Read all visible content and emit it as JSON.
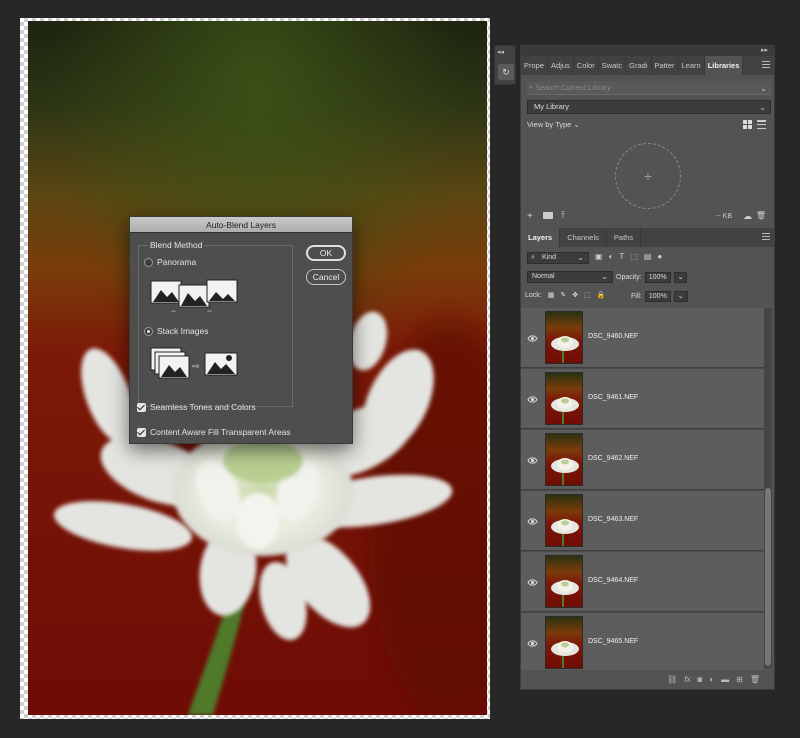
{
  "dialog": {
    "title": "Auto-Blend Layers",
    "blend_method_label": "Blend Method",
    "options": [
      {
        "label": "Panorama",
        "selected": false
      },
      {
        "label": "Stack Images",
        "selected": true
      }
    ],
    "checkboxes": [
      {
        "label": "Seamless Tones and Colors",
        "checked": true
      },
      {
        "label": "Content Aware Fill Transparent Areas",
        "checked": true
      }
    ],
    "ok_label": "OK",
    "cancel_label": "Cancel"
  },
  "panel_tabs": [
    "Prope",
    "Adjus",
    "Color",
    "Swatc",
    "Gradi",
    "Patter",
    "Learn",
    "Libraries"
  ],
  "libraries": {
    "search_placeholder": "Search Current Library",
    "selected_library": "My Library",
    "view_by": "View by Type",
    "storage": "-- KB"
  },
  "layers_panel": {
    "tabs": [
      "Layers",
      "Channels",
      "Paths"
    ],
    "filter_kind": "Kind",
    "blend_mode": "Normal",
    "opacity_label": "Opacity:",
    "opacity_value": "100%",
    "lock_label": "Lock:",
    "fill_label": "Fill:",
    "fill_value": "100%",
    "layers": [
      {
        "name": "DSC_9460.NEF"
      },
      {
        "name": "DSC_9461.NEF"
      },
      {
        "name": "DSC_9462.NEF"
      },
      {
        "name": "DSC_9463.NEF"
      },
      {
        "name": "DSC_9464.NEF"
      },
      {
        "name": "DSC_9465.NEF"
      }
    ]
  },
  "colors": {
    "workspace": "#272727",
    "panel": "#535353",
    "dialog": "#4e4e4e",
    "background_red": "#7a1206",
    "background_olive": "#2b3212"
  }
}
